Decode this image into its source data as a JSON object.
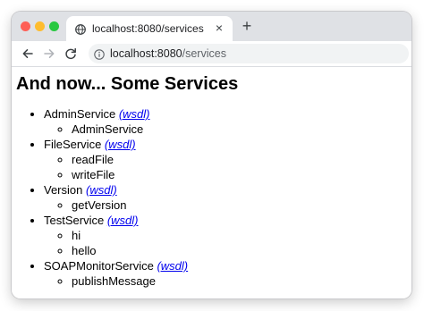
{
  "browser": {
    "tab_title": "localhost:8080/services",
    "url_host": "localhost:8080",
    "url_path": "/services",
    "new_tab_symbol": "+",
    "tab_close_symbol": "×"
  },
  "page": {
    "heading": "And now... Some Services",
    "services": [
      {
        "name": "AdminService",
        "wsdl_label": "(wsdl)",
        "operations": [
          "AdminService"
        ]
      },
      {
        "name": "FileService",
        "wsdl_label": "(wsdl)",
        "operations": [
          "readFile",
          "writeFile"
        ]
      },
      {
        "name": "Version",
        "wsdl_label": "(wsdl)",
        "operations": [
          "getVersion"
        ]
      },
      {
        "name": "TestService",
        "wsdl_label": "(wsdl)",
        "operations": [
          "hi",
          "hello"
        ]
      },
      {
        "name": "SOAPMonitorService",
        "wsdl_label": "(wsdl)",
        "operations": [
          "publishMessage"
        ]
      }
    ]
  },
  "colors": {
    "link": "#0000ee",
    "traffic_red": "#fe5f57",
    "traffic_yellow": "#febc2e",
    "traffic_green": "#28c840"
  },
  "icons": [
    "globe-icon",
    "close-icon",
    "plus-icon",
    "back-arrow-icon",
    "forward-arrow-icon",
    "reload-icon",
    "info-icon"
  ]
}
